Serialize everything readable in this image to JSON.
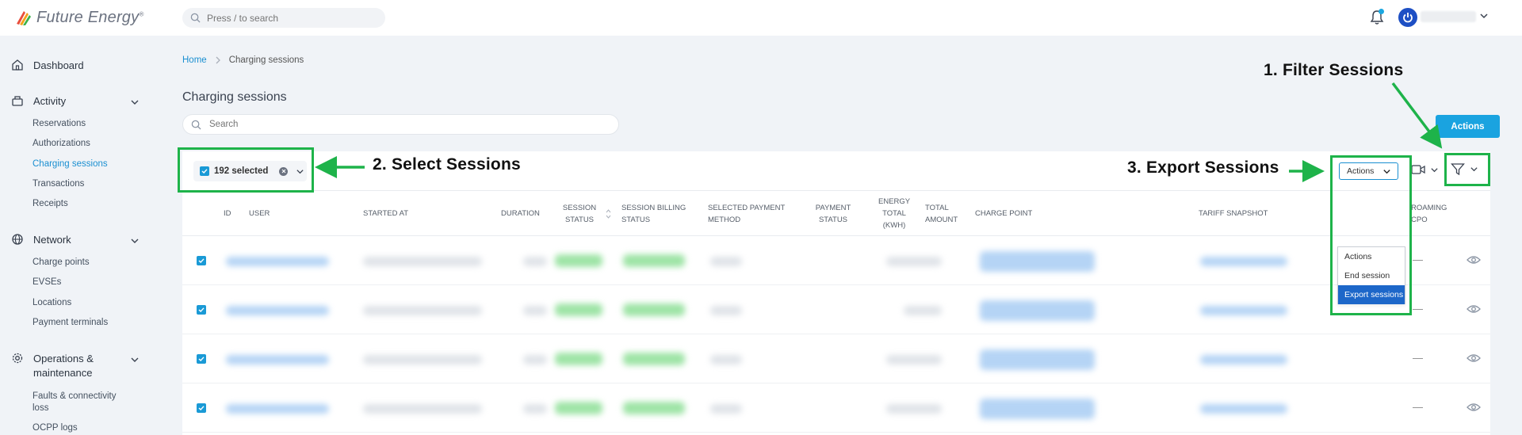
{
  "app": {
    "brand": "Future Energy",
    "brand_tm": "®"
  },
  "topbar": {
    "search_placeholder": "Press / to search"
  },
  "sidebar": {
    "dashboard": "Dashboard",
    "activity": "Activity",
    "activity_items": [
      "Reservations",
      "Authorizations",
      "Charging sessions",
      "Transactions",
      "Receipts"
    ],
    "network": "Network",
    "network_items": [
      "Charge points",
      "EVSEs",
      "Locations",
      "Payment terminals"
    ],
    "operations": "Operations &",
    "operations_line2": "maintenance",
    "operations_items": [
      "Faults & connectivity",
      "loss",
      "OCPP logs"
    ]
  },
  "breadcrumb": {
    "home": "Home",
    "current": "Charging sessions"
  },
  "page": {
    "title": "Charging sessions",
    "search_placeholder": "Search",
    "actions_button": "Actions"
  },
  "toolbar": {
    "selected_label": "192 selected",
    "actions_select": "Actions"
  },
  "table": {
    "headers": {
      "id": "ID",
      "user": "USER",
      "started_at": "STARTED AT",
      "duration": "DURATION",
      "session_status_1": "SESSION",
      "session_status_2": "STATUS",
      "billing_1": "SESSION BILLING",
      "billing_2": "STATUS",
      "payment_method_1": "SELECTED PAYMENT",
      "payment_method_2": "METHOD",
      "payment_status_1": "PAYMENT",
      "payment_status_2": "STATUS",
      "energy_1": "ENERGY",
      "energy_2": "TOTAL",
      "energy_3": "(KWH)",
      "amount_1": "TOTAL",
      "amount_2": "AMOUNT",
      "charge_point": "CHARGE POINT",
      "tariff": "TARIFF SNAPSHOT",
      "roaming_1": "ROAMING",
      "roaming_2": "CPO"
    },
    "roaming_placeholder": "—"
  },
  "dropdown": {
    "items": [
      "Actions",
      "End session",
      "Export sessions"
    ],
    "selected_index": 2
  },
  "annotations": {
    "filter": "1. Filter Sessions",
    "select": "2. Select Sessions",
    "export": "3. Export Sessions",
    "color": "#1eb34a"
  },
  "colors": {
    "accent": "#1aa3e0",
    "link": "#1a8fd1",
    "menu_selected": "#1d67c9"
  }
}
